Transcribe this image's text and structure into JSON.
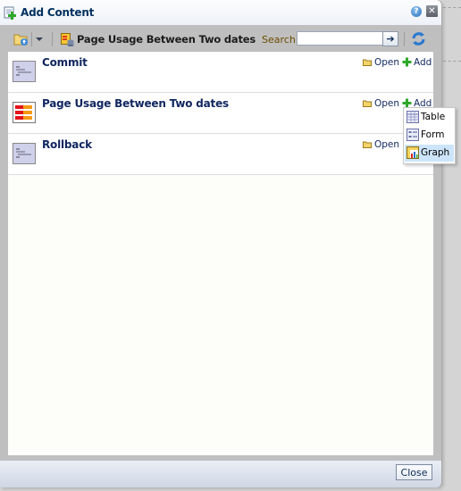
{
  "dialog": {
    "title": "Add Content",
    "help_icon": "help-icon",
    "close_icon": "close-icon"
  },
  "toolbar": {
    "folder_icon": "folder-up-icon",
    "dropdown_icon": "chevron-down-icon",
    "current_report": "Page Usage Between Two dates",
    "search_label": "Search",
    "search_value": "",
    "go_icon": "arrow-right-icon",
    "refresh_icon": "refresh-icon"
  },
  "items": [
    {
      "title": "Commit",
      "icon": "document-icon",
      "open_label": "Open",
      "add_label": "Add"
    },
    {
      "title": "Page Usage Between Two dates",
      "icon": "report-bars-icon",
      "open_label": "Open",
      "add_label": "Add"
    },
    {
      "title": "Rollback",
      "icon": "document-icon",
      "open_label": "Open"
    }
  ],
  "add_menu": {
    "options": [
      {
        "label": "Table",
        "icon": "table-icon",
        "selected": false
      },
      {
        "label": "Form",
        "icon": "form-icon",
        "selected": false
      },
      {
        "label": "Graph",
        "icon": "graph-icon",
        "selected": true
      }
    ]
  },
  "footer": {
    "close_label": "Close"
  }
}
